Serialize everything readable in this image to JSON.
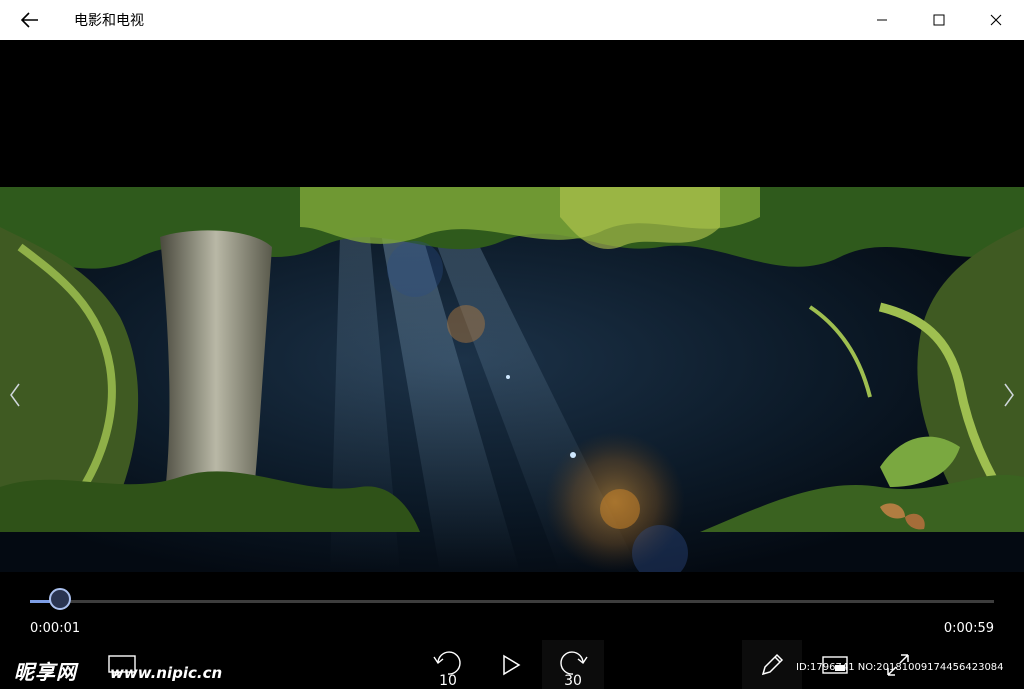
{
  "titlebar": {
    "app_title": "电影和电视"
  },
  "player": {
    "current_time": "0:00:01",
    "total_time": "0:00:59",
    "progress_fraction": 0.031,
    "skip_back_label": "10",
    "skip_forward_label": "30"
  },
  "watermark": {
    "site_logo": "昵享网",
    "url": "www.nipic.cn",
    "id_text": "ID:1796741 NO:20181009174456423084"
  },
  "colors": {
    "accent": "#7d9ee6",
    "titlebar_bg": "#ffffff",
    "player_bg": "#000000"
  }
}
